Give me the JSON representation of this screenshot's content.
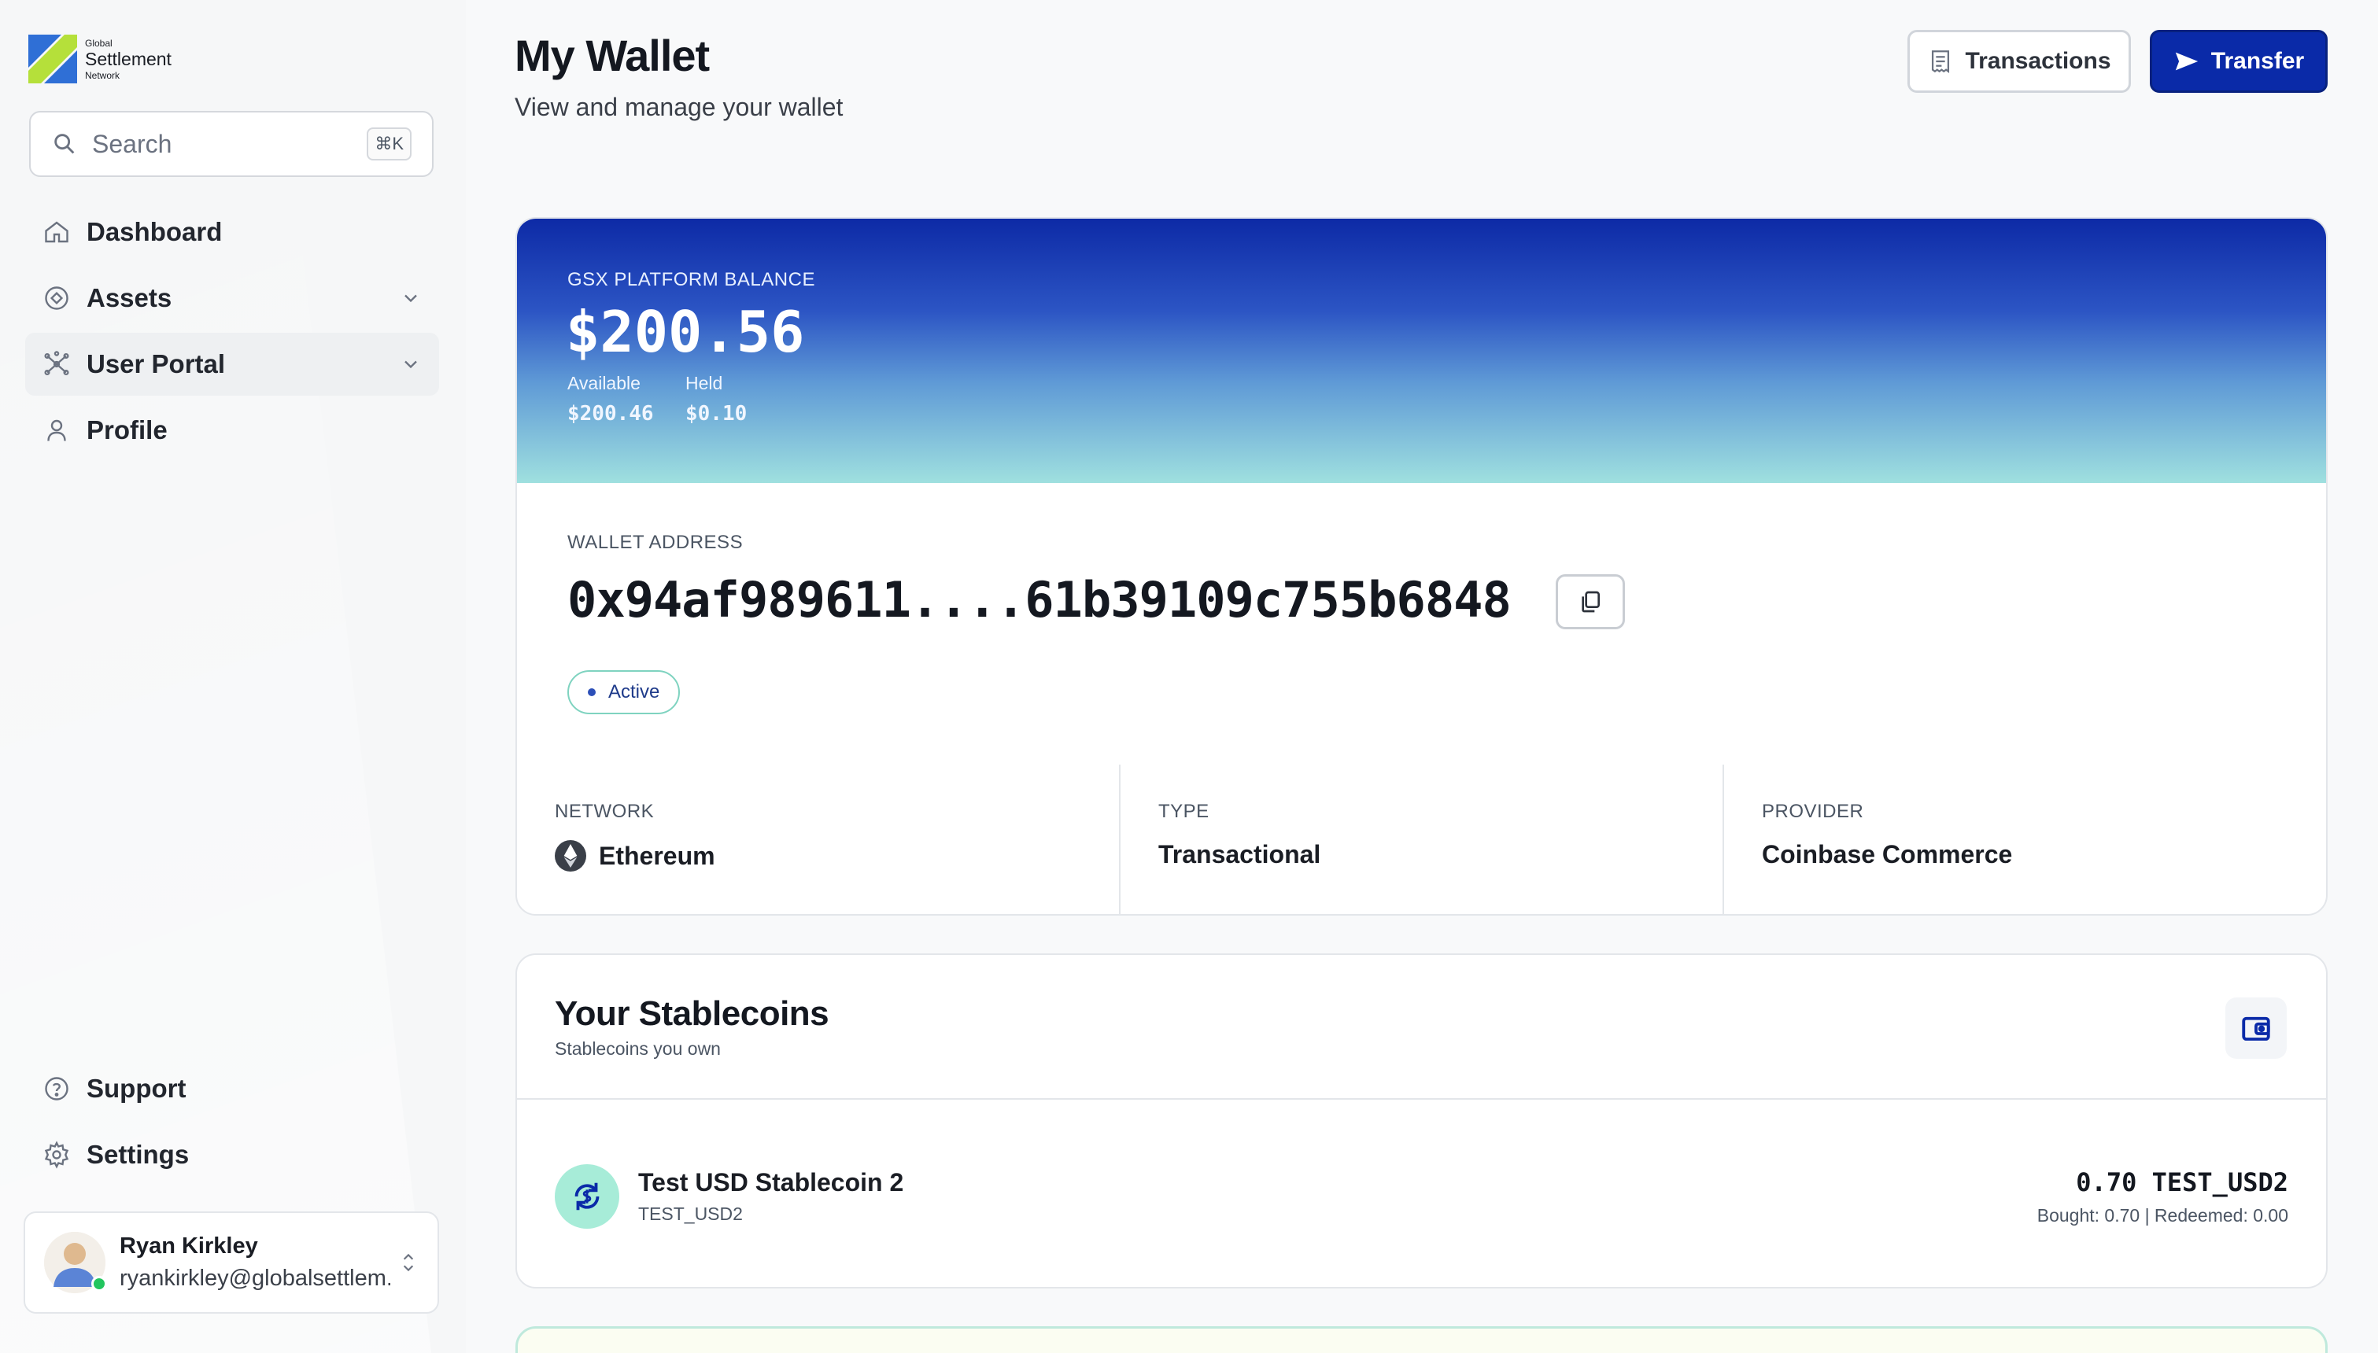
{
  "brand": {
    "line1": "Global",
    "line2": "Settlement",
    "line3": "Network"
  },
  "search": {
    "placeholder": "Search",
    "shortcut": "⌘K"
  },
  "nav": [
    {
      "label": "Dashboard",
      "icon": "home-icon"
    },
    {
      "label": "Assets",
      "icon": "assets-icon"
    },
    {
      "label": "User Portal",
      "icon": "network-icon"
    },
    {
      "label": "Profile",
      "icon": "user-icon"
    }
  ],
  "nav_bottom": [
    {
      "label": "Support",
      "icon": "help-icon"
    },
    {
      "label": "Settings",
      "icon": "gear-icon"
    }
  ],
  "user": {
    "name": "Ryan Kirkley",
    "email": "ryankirkley@globalsettlem..."
  },
  "header": {
    "title": "My Wallet",
    "subtitle": "View and manage your wallet",
    "transactions_label": "Transactions",
    "transfer_label": "Transfer"
  },
  "balance": {
    "label": "GSX PLATFORM BALANCE",
    "amount": "$200.56",
    "available_label": "Available",
    "available_value": "$200.46",
    "held_label": "Held",
    "held_value": "$0.10"
  },
  "wallet": {
    "address_label": "WALLET ADDRESS",
    "address": "0x94af989611....61b39109c755b6848",
    "status": "Active",
    "network_label": "NETWORK",
    "network": "Ethereum",
    "type_label": "TYPE",
    "type": "Transactional",
    "provider_label": "PROVIDER",
    "provider": "Coinbase Commerce"
  },
  "stablecoins": {
    "title": "Your Stablecoins",
    "subtitle": "Stablecoins you own",
    "items": [
      {
        "name": "Test USD Stablecoin 2",
        "symbol": "TEST_USD2",
        "amount": "0.70 TEST_USD2",
        "detail": "Bought: 0.70 | Redeemed: 0.00"
      }
    ]
  },
  "colors": {
    "primary": "#0a2aa8",
    "accent_teal": "#a7ecd8",
    "status_online": "#22c55e"
  }
}
